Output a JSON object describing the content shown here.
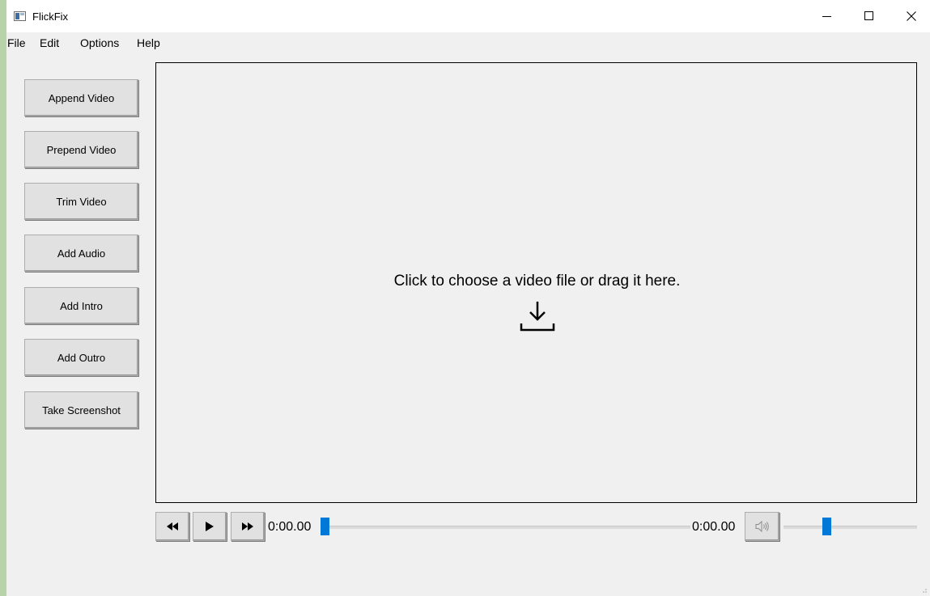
{
  "window": {
    "title": "FlickFix"
  },
  "title_controls": {
    "minimize": "minimize-icon",
    "maximize": "maximize-icon",
    "close": "close-icon"
  },
  "menu": [
    "File",
    "Edit",
    "Options",
    "Help"
  ],
  "sidebar": {
    "buttons": [
      "Append Video",
      "Prepend Video",
      "Trim Video",
      "Add Audio",
      "Add Intro",
      "Add Outro",
      "Take Screenshot"
    ]
  },
  "drop_area": {
    "text": "Click to choose a video file or drag it here.",
    "icon": "download-icon"
  },
  "player": {
    "rewind_icon": "rewind-icon",
    "play_icon": "play-icon",
    "forward_icon": "fast-forward-icon",
    "current_time": "0:00.00",
    "total_time": "0:00.00",
    "progress": 0,
    "volume_icon": "volume-icon",
    "volume_level": 0.31
  },
  "colors": {
    "accent": "#0078d7",
    "background": "#f0f0f0",
    "desktop": "#b9d3a8"
  }
}
